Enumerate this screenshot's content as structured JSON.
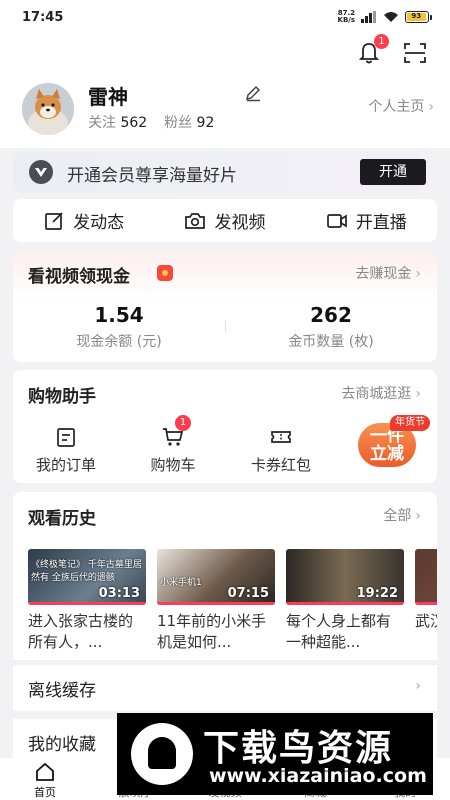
{
  "status_bar": {
    "time": "17:45",
    "net_speed_value": "87.2",
    "net_speed_unit": "KB/s",
    "battery": "93"
  },
  "header": {
    "notification_count": "1"
  },
  "profile": {
    "name": "雷神",
    "follow_label": "关注",
    "follow_count": "562",
    "fans_label": "粉丝",
    "fans_count": "92",
    "homepage_label": "个人主页"
  },
  "vip_banner": {
    "text": "开通会员尊享海量好片",
    "button": "开通"
  },
  "quick_actions": [
    {
      "label": "发动态",
      "icon": "edit-square-icon"
    },
    {
      "label": "发视频",
      "icon": "camera-icon"
    },
    {
      "label": "开直播",
      "icon": "video-camera-icon"
    }
  ],
  "cash_card": {
    "title": "看视频领现金",
    "link": "去赚现金",
    "balance_value": "1.54",
    "balance_label": "现金余额 (元)",
    "coins_value": "262",
    "coins_label": "金币数量 (枚)"
  },
  "shopping": {
    "title": "购物助手",
    "link": "去商城逛逛",
    "items": [
      {
        "label": "我的订单",
        "icon": "order-icon"
      },
      {
        "label": "购物车",
        "icon": "cart-icon",
        "badge": "1"
      },
      {
        "label": "卡券红包",
        "icon": "coupon-icon"
      }
    ],
    "promo_text_line1": "一件",
    "promo_text_line2": "立减",
    "promo_tag": "年货节"
  },
  "history": {
    "title": "观看历史",
    "link": "全部",
    "videos": [
      {
        "title": "进入张家古楼的所有人，...",
        "duration": "03:13",
        "caption": "《终极笔记》 千年古墓里居然有 全族后代的遗骸",
        "color": "#3a4a5a"
      },
      {
        "title": "11年前的小米手机是如何...",
        "duration": "07:15",
        "caption": "小米手机1",
        "color": "#5a4a3e"
      },
      {
        "title": "每个人身上都有一种超能...",
        "duration": "19:22",
        "caption": "",
        "color": "#3e3a34"
      },
      {
        "title": "武汉中国",
        "duration": "",
        "caption": "",
        "color": "#4a3c3c"
      }
    ]
  },
  "rows": {
    "offline": "离线缓存",
    "favorites": "我的收藏"
  },
  "bottom_nav": [
    "首页",
    "放映厅",
    "发视频",
    "商城",
    "我的"
  ],
  "watermark": {
    "title": "下载鸟资源",
    "url": "www.xiazainiao.com"
  },
  "colors": {
    "accent_red": "#ff3b4f",
    "vip_button": "#1b1b1f",
    "promo_orange": "#ef5a2a"
  }
}
